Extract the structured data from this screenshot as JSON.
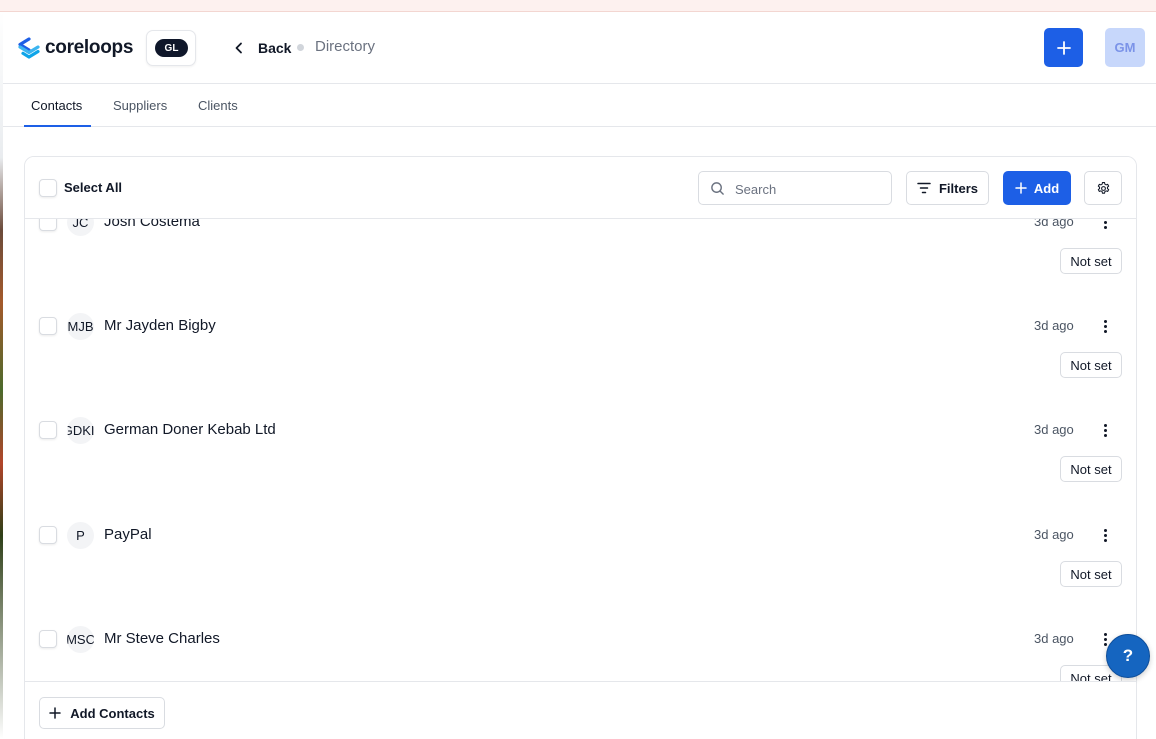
{
  "app": {
    "logo_text": "coreloops",
    "org_initials": "GL",
    "back_label": "Back",
    "page_title": "Directory",
    "user_initials": "GM",
    "accent_color": "#1d5fe6"
  },
  "tabs": [
    {
      "label": "Contacts",
      "active": true
    },
    {
      "label": "Suppliers",
      "active": false
    },
    {
      "label": "Clients",
      "active": false
    }
  ],
  "toolbar": {
    "select_all_label": "Select All",
    "search_placeholder": "Search",
    "filters_label": "Filters",
    "add_label": "Add"
  },
  "contacts": [
    {
      "initials": "JC",
      "name": "Josh Costema",
      "time": "3d ago",
      "status": "Not set"
    },
    {
      "initials": "MJB",
      "name": "Mr Jayden Bigby",
      "time": "3d ago",
      "status": "Not set"
    },
    {
      "initials": "GDKL",
      "name": "German Doner Kebab Ltd",
      "time": "3d ago",
      "status": "Not set"
    },
    {
      "initials": "P",
      "name": "PayPal",
      "time": "3d ago",
      "status": "Not set"
    },
    {
      "initials": "MSC",
      "name": "Mr Steve Charles",
      "time": "3d ago",
      "status": "Not set"
    }
  ],
  "footer": {
    "add_contacts_label": "Add Contacts"
  },
  "help_label": "?",
  "icons": [
    "coreloops-logo-icon",
    "chevron-left-icon",
    "plus-icon",
    "search-icon",
    "filter-icon",
    "gear-icon",
    "kebab-menu-icon",
    "help-icon"
  ]
}
